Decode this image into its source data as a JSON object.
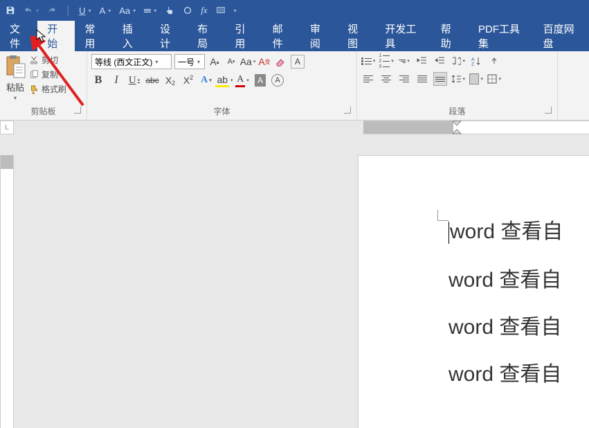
{
  "quickAccess": {
    "underline": "U",
    "fontGlyph": "A",
    "caseGlyph": "Aa"
  },
  "tabs": {
    "file": "文件",
    "home": "开始",
    "common": "常用",
    "insert": "插入",
    "design": "设计",
    "layout": "布局",
    "reference": "引用",
    "mail": "邮件",
    "review": "审阅",
    "view": "视图",
    "dev": "开发工具",
    "help": "帮助",
    "pdf": "PDF工具集",
    "baidu": "百度网盘"
  },
  "clipboard": {
    "paste": "粘贴",
    "cut": "剪切",
    "copy": "复制",
    "formatPainter": "格式刷",
    "groupLabel": "剪贴板"
  },
  "font": {
    "name": "等线 (西文正文)",
    "size": "一号",
    "growGlyph": "A",
    "shrinkGlyph": "A",
    "caseGlyph": "Aa",
    "phonetic": "A",
    "clearFmt": "A",
    "bold": "B",
    "italic": "I",
    "underline": "U",
    "strike": "abc",
    "x": "X",
    "effectsA": "A",
    "highlightGlyph": "ab",
    "fontcolorA": "A",
    "shadeA": "A",
    "circleA": "A",
    "groupLabel": "字体"
  },
  "paragraph": {
    "groupLabel": "段落"
  },
  "ruler": {
    "corner": "L"
  },
  "document": {
    "lines": [
      "word 查看自",
      "word 查看自",
      "word 查看自",
      "word 查看自"
    ]
  }
}
